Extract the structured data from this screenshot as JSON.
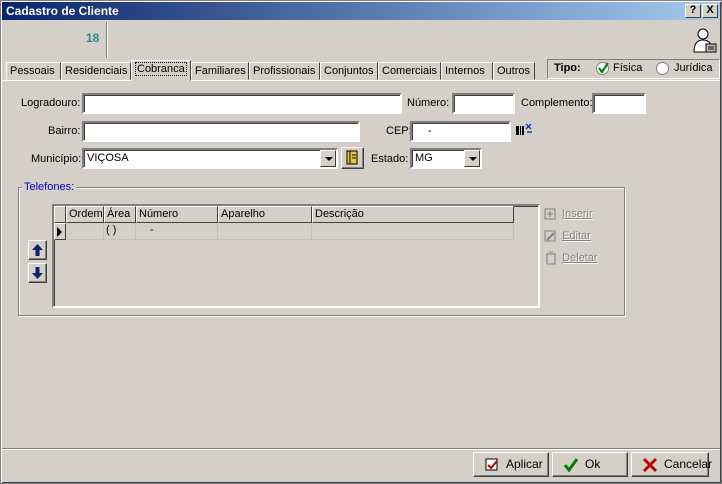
{
  "window": {
    "title": "Cadastro de Cliente",
    "help_label": "?",
    "close_label": "X"
  },
  "header": {
    "client_id": "18",
    "user_icon": "user-settings-icon"
  },
  "tabs": [
    {
      "label": "Pessoais"
    },
    {
      "label": "Residenciais"
    },
    {
      "label": "Cobranca"
    },
    {
      "label": "Familiares"
    },
    {
      "label": "Profissionais"
    },
    {
      "label": "Conjuntos"
    },
    {
      "label": "Comerciais"
    },
    {
      "label": "Internos"
    },
    {
      "label": "Outros"
    }
  ],
  "tipo": {
    "label": "Tipo:",
    "options": [
      {
        "label": "Física",
        "selected": true
      },
      {
        "label": "Jurídica",
        "selected": false
      }
    ]
  },
  "form": {
    "logradouro_label": "Logradouro:",
    "logradouro_value": "",
    "numero_label": "Número:",
    "numero_value": "",
    "complemento_label": "Complemento:",
    "complemento_value": "",
    "bairro_label": "Bairro:",
    "bairro_value": "",
    "cep_label": "CEP:",
    "cep_value": "-",
    "municipio_label": "Município:",
    "municipio_value": "VIÇOSA",
    "estado_label": "Estado:",
    "estado_value": "MG"
  },
  "telefones": {
    "title": "Telefones:",
    "columns": [
      "Ordem",
      "Área",
      "Número",
      "Aparelho",
      "Descrição"
    ],
    "rows": [
      {
        "ordem": "",
        "area": "( )",
        "numero": "-",
        "aparelho": "",
        "descricao": ""
      }
    ],
    "actions": {
      "inserir": "Inserir",
      "editar": "Editar",
      "deletar": "Deletar"
    }
  },
  "footer": {
    "aplicar": "Aplicar",
    "ok": "Ok",
    "cancelar": "Cancelar"
  },
  "colors": {
    "title_start": "#0a246a",
    "title_end": "#a6caf0",
    "face": "#d4d0c8",
    "group_title": "#0000cc",
    "client_id": "#2a8a8a"
  }
}
